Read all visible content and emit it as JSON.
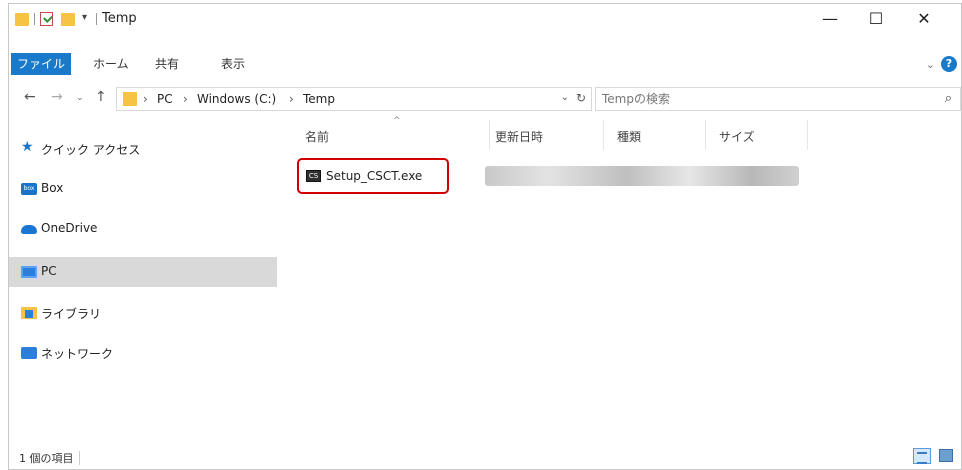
{
  "window": {
    "title": "Temp",
    "qa_dropdown": "▾",
    "minimize": "—",
    "maximize": "☐",
    "close": "✕"
  },
  "ribbon": {
    "tabs": [
      {
        "label": "ファイル"
      },
      {
        "label": "ホーム"
      },
      {
        "label": "共有"
      },
      {
        "label": "表示"
      }
    ],
    "expand": "⌄",
    "help": "?"
  },
  "address": {
    "back": "←",
    "forward": "→",
    "recent": "⌄",
    "up": "↑",
    "breadcrumbs": [
      "PC",
      "Windows (C:)",
      "Temp"
    ],
    "separator": "›",
    "dropdown": "⌄",
    "refresh": "↻"
  },
  "search": {
    "placeholder": "Tempの検索",
    "icon": "⌕"
  },
  "navpane": {
    "items": [
      {
        "label": "クイック アクセス",
        "icon": "star-icon"
      },
      {
        "label": "Box",
        "icon": "box-icon"
      },
      {
        "label": "OneDrive",
        "icon": "cloud-icon"
      },
      {
        "label": "PC",
        "icon": "pc-icon",
        "selected": true
      },
      {
        "label": "ライブラリ",
        "icon": "library-icon"
      },
      {
        "label": "ネットワーク",
        "icon": "network-icon"
      }
    ],
    "star_glyph": "★",
    "box_glyph": "box"
  },
  "columns": {
    "name": "名前",
    "modified": "更新日時",
    "type": "種類",
    "size": "サイズ",
    "sort_glyph": "^"
  },
  "files": [
    {
      "name": "Setup_CSCT.exe",
      "icon_glyph": "CS"
    }
  ],
  "status": {
    "count": "1 個の項目"
  },
  "colors": {
    "accent": "#1979ca",
    "highlight_border": "#d00000",
    "selected_bg": "#d9d9d9"
  }
}
